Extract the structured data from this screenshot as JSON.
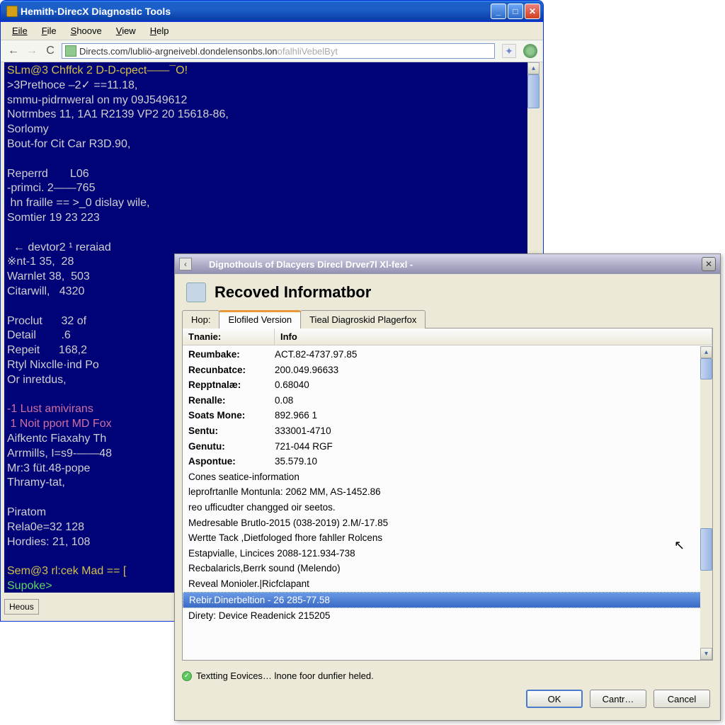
{
  "main_window": {
    "title": "Hemith·DirecX Diagnostic Tools",
    "menu": [
      "Eile",
      "File",
      "Shoove",
      "View",
      "Help"
    ],
    "address": {
      "black": "Directs.com/lubliö-argneivebl.dondelensonbs.lon",
      "gray": "ofalhliVebelByt"
    },
    "status_button": "Heous"
  },
  "terminal": {
    "lines": [
      {
        "cls": "yellow",
        "txt": "SLm@3 Chffck 2 D-D-cpect——¯O!"
      },
      {
        "cls": "",
        "txt": ">3Prethoce –2✓ ==11.18,"
      },
      {
        "cls": "",
        "txt": "smmu-pidrnweral on my 09J549612"
      },
      {
        "cls": "",
        "txt": "Notrmbes 11, 1A1 R2139 VP2 20 15618-86,"
      },
      {
        "cls": "",
        "txt": "Sorlomy"
      },
      {
        "cls": "",
        "txt": "Bout-for Cit Car R3D.90,"
      },
      {
        "cls": "",
        "txt": ""
      },
      {
        "cls": "",
        "txt": "Reperrd       L06"
      },
      {
        "cls": "",
        "txt": "-primci. 2——765"
      },
      {
        "cls": "",
        "txt": " hn fraille == >_0 dislay wile,"
      },
      {
        "cls": "",
        "txt": "Somtier 19 23 223"
      },
      {
        "cls": "",
        "txt": ""
      },
      {
        "cls": "",
        "txt": "  ← devtor2 ¹ reraiad"
      },
      {
        "cls": "",
        "txt": "※nt-1 35,  28"
      },
      {
        "cls": "",
        "txt": "Warnlet 38,  503"
      },
      {
        "cls": "",
        "txt": "Citarwill,   4320"
      },
      {
        "cls": "",
        "txt": ""
      },
      {
        "cls": "",
        "txt": "Proclut      32 of"
      },
      {
        "cls": "",
        "txt": "Detail        .6"
      },
      {
        "cls": "",
        "txt": "Repeit      168,2"
      },
      {
        "cls": "",
        "txt": "Rtyl Nixclle·ind Po"
      },
      {
        "cls": "",
        "txt": "Or inretdus,"
      },
      {
        "cls": "",
        "txt": ""
      },
      {
        "cls": "magenta",
        "txt": "-1 Lust amivirans"
      },
      {
        "cls": "magenta",
        "txt": " 1 Noit pport MD Fox"
      },
      {
        "cls": "",
        "txt": "Aifkentc Fiaxahy Th"
      },
      {
        "cls": "",
        "txt": "Arrmills, I=s9-——48"
      },
      {
        "cls": "",
        "txt": "Mr:3 füt.48-pope"
      },
      {
        "cls": "",
        "txt": "Thramy-tat,"
      },
      {
        "cls": "",
        "txt": ""
      },
      {
        "cls": "",
        "txt": "Piratom"
      },
      {
        "cls": "",
        "txt": "Rela0e=32 128"
      },
      {
        "cls": "",
        "txt": "Hordies: 21, 108"
      },
      {
        "cls": "",
        "txt": ""
      },
      {
        "cls": "yellow",
        "txt": "Sem@3 rl:cek Mad == ["
      },
      {
        "cls": "green",
        "txt": "Supoke>"
      }
    ]
  },
  "dialog": {
    "title": "Dignothouls of Dlacyers Direcl Drver7l Xl-fexl  -",
    "header": "Recoved Informatbor",
    "tabs": [
      "Hop:",
      "Elofiled Version",
      "Tieal Diagroskid Plagerfox"
    ],
    "active_tab": 1,
    "list_header": [
      "Tnanie:",
      "Info"
    ],
    "kv_rows": [
      {
        "k": "Reumbake:",
        "v": "ACT.82-4737.97.85"
      },
      {
        "k": "Recunbatce:",
        "v": "200.049.96633"
      },
      {
        "k": "Repptnalæ:",
        "v": "0.68040"
      },
      {
        "k": "Renalle:",
        "v": "0.08"
      },
      {
        "k": "Soats Mone:",
        "v": "892.966 1"
      },
      {
        "k": "Sentu:",
        "v": "333001-4710"
      },
      {
        "k": "Genutu:",
        "v": "721-044 RGF"
      },
      {
        "k": "Aspontue:",
        "v": "35.579.10"
      }
    ],
    "plain_rows": [
      "Cones seatice-information",
      "leprofrtanlle Montunla: 2062 MM, AS-1452.86",
      "reo ufficudter changged oir seetos.",
      "Medresable Brutlo-2015 (038-2019) 2.M/-17.85",
      "Wertte Tack ,Dietfologed  fhore fahller Rolcens",
      "Estapvialle, Lincices 2088-121.934-738",
      "Recbalaricls,Berrk sound (Melendo)",
      "Reveal Monioler.|Ricfclapant"
    ],
    "selected_row": "Rebir.Dinerbeltion - 26 285-77.58",
    "trailing_rows": [
      "Direty: Device Readenick 215205"
    ],
    "status": "Textting Eovices…   lnone foor dunfier heled.",
    "buttons": [
      "OK",
      "Cantr…",
      "Cancel"
    ]
  }
}
